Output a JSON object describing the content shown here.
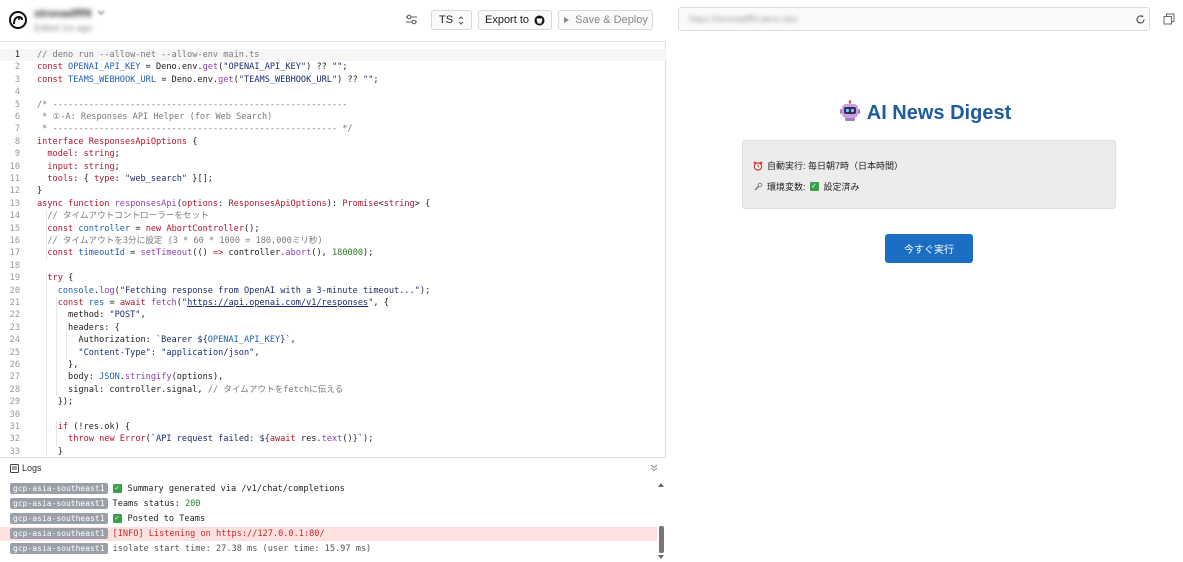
{
  "project": {
    "name": "stronadfff9",
    "updated": "Edited 1m ago"
  },
  "toolbar": {
    "lang": "TS",
    "export_label": "Export to",
    "deploy_label": "Save & Deploy"
  },
  "preview": {
    "url": "https://stronadfff9.deno.dev",
    "title": "AI News Digest",
    "schedule_label": "自動実行: 毎日朝7時（日本時間）",
    "env_label": "環境変数:",
    "env_status": "設定済み",
    "run_button": "今すぐ実行"
  },
  "logs": {
    "title": "Logs",
    "entries": [
      {
        "region": "gcp-asia-southeast1",
        "check": true,
        "text": "Summary generated via /v1/chat/completions",
        "level": "log"
      },
      {
        "region": "gcp-asia-southeast1",
        "check": false,
        "text": "Teams status: ",
        "num": "200",
        "level": "log"
      },
      {
        "region": "gcp-asia-southeast1",
        "check": true,
        "text": "Posted to Teams",
        "level": "log"
      },
      {
        "region": "gcp-asia-southeast1",
        "check": false,
        "text": "[INFO] Listening on https://127.0.0.1:80/",
        "level": "error"
      },
      {
        "region": "gcp-asia-southeast1",
        "check": false,
        "text": "isolate start time: 27.38 ms (user time: 15.97 ms)",
        "level": "dim"
      }
    ]
  },
  "code": [
    [
      [
        "comment",
        "// deno run --allow-net --allow-env main.ts"
      ]
    ],
    [
      [
        "kw",
        "const "
      ],
      [
        "const",
        "OPENAI_API_KEY"
      ],
      [
        "plain",
        " = Deno.env."
      ],
      [
        "fn",
        "get"
      ],
      [
        "plain",
        "("
      ],
      [
        "str",
        "\"OPENAI_API_KEY\""
      ],
      [
        "plain",
        ") ?? "
      ],
      [
        "str",
        "\"\""
      ],
      [
        "plain",
        ";"
      ]
    ],
    [
      [
        "kw",
        "const "
      ],
      [
        "const",
        "TEAMS_WEBHOOK_URL"
      ],
      [
        "plain",
        " = Deno.env."
      ],
      [
        "fn",
        "get"
      ],
      [
        "plain",
        "("
      ],
      [
        "str",
        "\"TEAMS_WEBHOOK_URL\""
      ],
      [
        "plain",
        ") ?? "
      ],
      [
        "str",
        "\"\""
      ],
      [
        "plain",
        ";"
      ]
    ],
    [],
    [
      [
        "comment",
        "/* ---------------------------------------------------------"
      ]
    ],
    [
      [
        "comment",
        " * ①-A: Responses API Helper (for Web Search)"
      ]
    ],
    [
      [
        "comment",
        " * ------------------------------------------------------- */"
      ]
    ],
    [
      [
        "kw",
        "interface "
      ],
      [
        "type",
        "ResponsesApiOptions"
      ],
      [
        "plain",
        " {"
      ]
    ],
    [
      [
        "plain",
        "  "
      ],
      [
        "kw",
        "model"
      ],
      [
        "plain",
        ": "
      ],
      [
        "type",
        "string"
      ],
      [
        "plain",
        ";"
      ]
    ],
    [
      [
        "plain",
        "  "
      ],
      [
        "kw",
        "input"
      ],
      [
        "plain",
        ": "
      ],
      [
        "type",
        "string"
      ],
      [
        "plain",
        ";"
      ]
    ],
    [
      [
        "plain",
        "  "
      ],
      [
        "kw",
        "tools"
      ],
      [
        "plain",
        ": { "
      ],
      [
        "kw",
        "type"
      ],
      [
        "plain",
        ": "
      ],
      [
        "str",
        "\"web_search\""
      ],
      [
        "plain",
        " }[];"
      ]
    ],
    [
      [
        "plain",
        "}"
      ]
    ],
    [
      [
        "kw",
        "async function "
      ],
      [
        "fn",
        "responsesApi"
      ],
      [
        "plain",
        "("
      ],
      [
        "kw",
        "options"
      ],
      [
        "plain",
        ": "
      ],
      [
        "type",
        "ResponsesApiOptions"
      ],
      [
        "plain",
        "): "
      ],
      [
        "type",
        "Promise"
      ],
      [
        "plain",
        "<"
      ],
      [
        "type",
        "string"
      ],
      [
        "plain",
        "> {"
      ]
    ],
    [
      [
        "comment",
        "  // タイムアウトコントローラーをセット"
      ]
    ],
    [
      [
        "plain",
        "  "
      ],
      [
        "kw",
        "const "
      ],
      [
        "const",
        "controller"
      ],
      [
        "plain",
        " = "
      ],
      [
        "kw",
        "new "
      ],
      [
        "type",
        "AbortController"
      ],
      [
        "plain",
        "();"
      ]
    ],
    [
      [
        "comment",
        "  // タイムアウトを3分に設定 (3 * 60 * 1000 = 180,000ミリ秒)"
      ]
    ],
    [
      [
        "plain",
        "  "
      ],
      [
        "kw",
        "const "
      ],
      [
        "const",
        "timeoutId"
      ],
      [
        "plain",
        " = "
      ],
      [
        "fn",
        "setTimeout"
      ],
      [
        "plain",
        "(() "
      ],
      [
        "kw",
        "=>"
      ],
      [
        "plain",
        " controller."
      ],
      [
        "fn",
        "abort"
      ],
      [
        "plain",
        "(), "
      ],
      [
        "num",
        "180000"
      ],
      [
        "plain",
        ");"
      ]
    ],
    [],
    [
      [
        "plain",
        "  "
      ],
      [
        "kw",
        "try"
      ],
      [
        "plain",
        " {"
      ]
    ],
    [
      [
        "plain",
        "    "
      ],
      [
        "const",
        "console"
      ],
      [
        "plain",
        "."
      ],
      [
        "fn",
        "log"
      ],
      [
        "plain",
        "("
      ],
      [
        "str",
        "\"Fetching response from OpenAI with a 3-minute timeout...\""
      ],
      [
        "plain",
        ");"
      ]
    ],
    [
      [
        "plain",
        "    "
      ],
      [
        "kw",
        "const "
      ],
      [
        "const",
        "res"
      ],
      [
        "plain",
        " = "
      ],
      [
        "kw",
        "await "
      ],
      [
        "fn",
        "fetch"
      ],
      [
        "plain",
        "("
      ],
      [
        "str",
        "\""
      ],
      [
        "url",
        "https://api.openai.com/v1/responses"
      ],
      [
        "str",
        "\""
      ],
      [
        "plain",
        ", {"
      ]
    ],
    [
      [
        "plain",
        "      method: "
      ],
      [
        "str",
        "\"POST\""
      ],
      [
        "plain",
        ","
      ]
    ],
    [
      [
        "plain",
        "      headers: {"
      ]
    ],
    [
      [
        "plain",
        "        Authorization: "
      ],
      [
        "str",
        "`Bearer ${"
      ],
      [
        "const",
        "OPENAI_API_KEY"
      ],
      [
        "str",
        "}`"
      ],
      [
        "plain",
        ","
      ]
    ],
    [
      [
        "plain",
        "        "
      ],
      [
        "str",
        "\"Content-Type\""
      ],
      [
        "plain",
        ": "
      ],
      [
        "str",
        "\"application/json\""
      ],
      [
        "plain",
        ","
      ]
    ],
    [
      [
        "plain",
        "      },"
      ]
    ],
    [
      [
        "plain",
        "      body: "
      ],
      [
        "const",
        "JSON"
      ],
      [
        "plain",
        "."
      ],
      [
        "fn",
        "stringify"
      ],
      [
        "plain",
        "(options),"
      ]
    ],
    [
      [
        "plain",
        "      signal: controller.signal, "
      ],
      [
        "comment",
        "// タイムアウトをfetchに伝える"
      ]
    ],
    [
      [
        "plain",
        "    });"
      ]
    ],
    [],
    [
      [
        "plain",
        "    "
      ],
      [
        "kw",
        "if"
      ],
      [
        "plain",
        " (!res.ok) {"
      ]
    ],
    [
      [
        "plain",
        "      "
      ],
      [
        "kw",
        "throw "
      ],
      [
        "kw",
        "new "
      ],
      [
        "type",
        "Error"
      ],
      [
        "plain",
        "("
      ],
      [
        "str",
        "`API request failed: ${"
      ],
      [
        "kw",
        "await "
      ],
      [
        "plain",
        "res."
      ],
      [
        "fn",
        "text"
      ],
      [
        "plain",
        "()"
      ],
      [
        "str",
        "}`"
      ],
      [
        "plain",
        ");"
      ]
    ],
    [
      [
        "plain",
        "    }"
      ]
    ]
  ]
}
